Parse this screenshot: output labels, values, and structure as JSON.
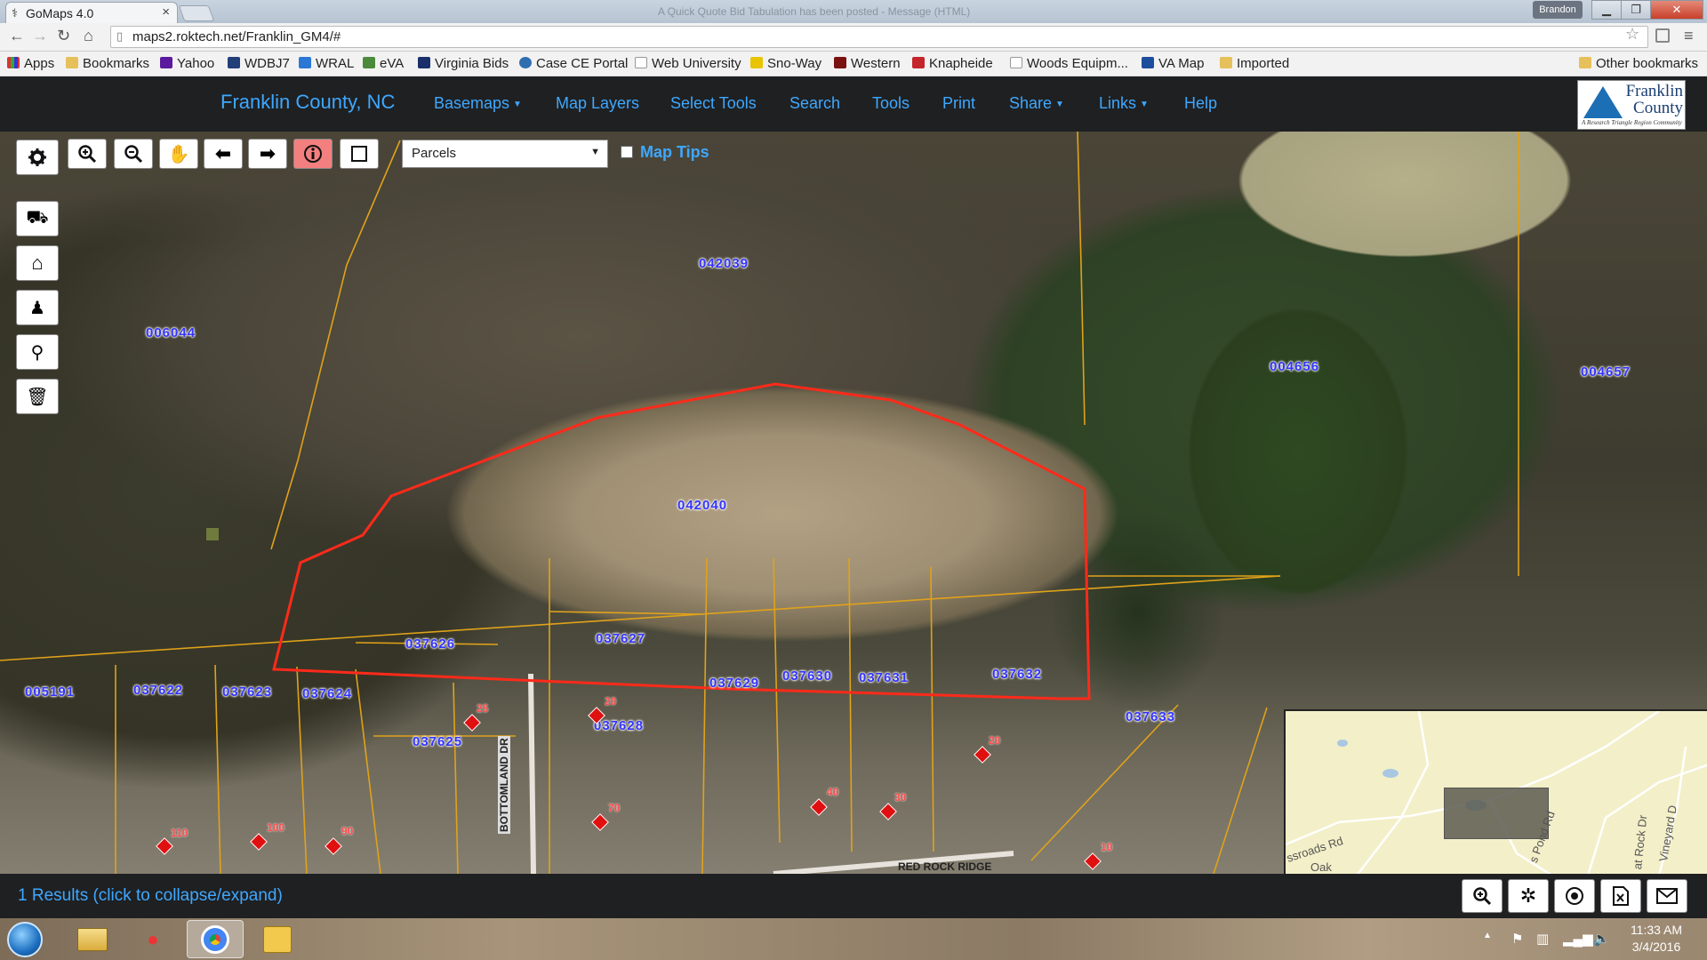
{
  "browser": {
    "tab_title": "GoMaps 4.0",
    "tab_close": "×",
    "notification_text": "A Quick Quote Bid Tabulation has been posted - Message (HTML)",
    "user_name": "Brandon",
    "url": "maps2.roktech.net/Franklin_GM4/#",
    "bookmarks": [
      "Apps",
      "Bookmarks",
      "Yahoo",
      "WDBJ7",
      "WRAL",
      "eVA",
      "Virginia Bids",
      "Case CE Portal",
      "Web University",
      "Sno-Way",
      "Western",
      "Knapheide",
      "Woods Equipm...",
      "VA Map",
      "Imported"
    ],
    "other_bookmarks": "Other bookmarks"
  },
  "app": {
    "title": "Franklin County, NC",
    "nav": [
      "Basemaps",
      "Map Layers",
      "Select Tools",
      "Search",
      "Tools",
      "Print",
      "Share",
      "Links",
      "Help"
    ],
    "logo_text_1": "Franklin",
    "logo_text_2": "County",
    "logo_tagline": "A Research Triangle Region Community"
  },
  "map": {
    "layer_select": "Parcels",
    "map_tips_label": "Map Tips",
    "map_tips_checked": false,
    "parcels": [
      "042039",
      "006044",
      "004656",
      "004657",
      "042040",
      "037626",
      "037627",
      "037622",
      "037623",
      "037624",
      "005191",
      "037625",
      "037629",
      "037630",
      "037631",
      "037632",
      "037628",
      "037633"
    ],
    "addresses": [
      "25",
      "20",
      "110",
      "100",
      "90",
      "70",
      "40",
      "30",
      "20",
      "10"
    ],
    "street_name": "BOTTOMLAND DR",
    "street_name_2": "RED ROCK RIDGE",
    "selected_parcel": "042040",
    "selected_color": "#ff2a1a",
    "parcel_line_color": "#e0a21a"
  },
  "overview": {
    "roads": [
      "ssroads Rd",
      "Oak",
      "s Pond Rd",
      "at Rock Dr",
      "Vineyard D"
    ]
  },
  "results": {
    "text": "1 Results (click to collapse/expand)"
  },
  "taskbar": {
    "time": "11:33 AM",
    "date": "3/4/2016"
  }
}
